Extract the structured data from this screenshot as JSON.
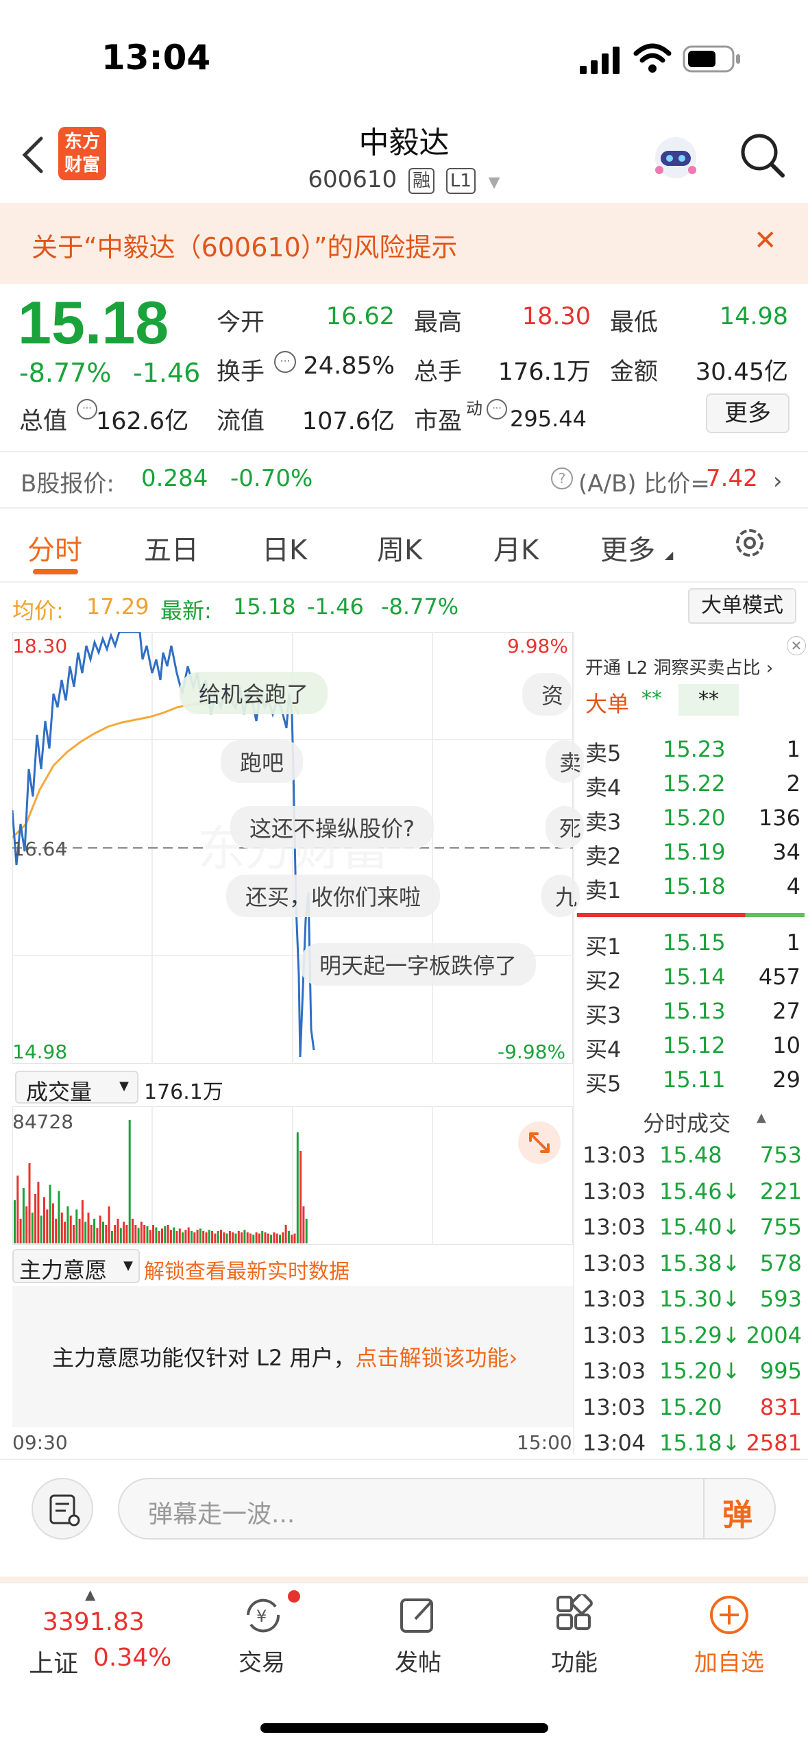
{
  "status_bar": {
    "time": "13:04"
  },
  "header": {
    "logo_text": "东方\n财富",
    "title": "中毅达",
    "code": "600610",
    "tag1": "融",
    "tag2": "L1"
  },
  "risk_banner": {
    "text": "关于“中毅达（600610）”的风险提示",
    "close": "✕"
  },
  "quote": {
    "price": "15.18",
    "change_pct": "-8.77%",
    "change": "-1.46",
    "open_label": "今开",
    "open": "16.62",
    "high_label": "最高",
    "high": "18.30",
    "low_label": "最低",
    "low": "14.98",
    "turnover_label": "换手",
    "turnover": "24.85%",
    "volume_label": "总手",
    "volume": "176.1万",
    "amount_label": "金额",
    "amount": "30.45亿",
    "mktcap_label": "总值",
    "mktcap": "162.6亿",
    "float_label": "流值",
    "float": "107.6亿",
    "pe_label": "市盈",
    "pe_sup": "动",
    "pe": "295.44",
    "more_button": "更多"
  },
  "bshare": {
    "label": "B股报价:",
    "price": "0.284",
    "change": "-0.70%",
    "ratio_label": "(A/B) 比价=",
    "ratio": "7.42"
  },
  "tabs": [
    {
      "label": "分时"
    },
    {
      "label": "五日"
    },
    {
      "label": "日K"
    },
    {
      "label": "周K"
    },
    {
      "label": "月K"
    },
    {
      "label": "更多"
    }
  ],
  "chart_info": {
    "avg_label": "均价:",
    "avg": "17.29",
    "latest_label": "最新:",
    "latest": "15.18",
    "chg": "-1.46",
    "pct": "-8.77%",
    "mode_button": "大单模式"
  },
  "chart_axes": {
    "top_price": "18.30",
    "mid_price": "16.64",
    "bottom_price": "14.98",
    "top_pct": "9.98%",
    "bottom_pct": "-9.98%",
    "start_time": "09:30",
    "end_time": "15:00"
  },
  "bubbles": [
    "给机会跑了",
    "跑吧",
    "这还不操纵股价?",
    "还买，收你们来啦",
    "明天起一字板跌停了",
    "资",
    "卖",
    "死",
    "九"
  ],
  "volume": {
    "selector": "成交量",
    "total": "176.1万",
    "max_label": "84728"
  },
  "main_force": {
    "selector": "主力意愿",
    "unlock_text": "解锁查看最新实时数据",
    "notice": "主力意愿功能仅针对 L2 用户，",
    "notice_link": "点击解锁该功能›"
  },
  "order_book": {
    "promo": "开通 L2 洞察买卖占比 ›",
    "big_order": "大单",
    "big_mask1": "**",
    "big_mask2": "**",
    "asks": [
      {
        "label": "卖5",
        "price": "15.23",
        "vol": "1"
      },
      {
        "label": "卖4",
        "price": "15.22",
        "vol": "2"
      },
      {
        "label": "卖3",
        "price": "15.20",
        "vol": "136"
      },
      {
        "label": "卖2",
        "price": "15.19",
        "vol": "34"
      },
      {
        "label": "卖1",
        "price": "15.18",
        "vol": "4"
      }
    ],
    "bids": [
      {
        "label": "买1",
        "price": "15.15",
        "vol": "1"
      },
      {
        "label": "买2",
        "price": "15.14",
        "vol": "457"
      },
      {
        "label": "买3",
        "price": "15.13",
        "vol": "27"
      },
      {
        "label": "买4",
        "price": "15.12",
        "vol": "10"
      },
      {
        "label": "买5",
        "price": "15.11",
        "vol": "29"
      }
    ]
  },
  "trades": {
    "title": "分时成交",
    "rows": [
      {
        "time": "13:03",
        "price": "15.48",
        "dir": "",
        "vol": "753",
        "color": "green"
      },
      {
        "time": "13:03",
        "price": "15.46",
        "dir": "↓",
        "vol": "221",
        "color": "green"
      },
      {
        "time": "13:03",
        "price": "15.40",
        "dir": "↓",
        "vol": "755",
        "color": "green"
      },
      {
        "time": "13:03",
        "price": "15.38",
        "dir": "↓",
        "vol": "578",
        "color": "green"
      },
      {
        "time": "13:03",
        "price": "15.30",
        "dir": "↓",
        "vol": "593",
        "color": "green"
      },
      {
        "time": "13:03",
        "price": "15.29",
        "dir": "↓",
        "vol": "2004",
        "color": "green"
      },
      {
        "time": "13:03",
        "price": "15.20",
        "dir": "↓",
        "vol": "995",
        "color": "green"
      },
      {
        "time": "13:03",
        "price": "15.20",
        "dir": "",
        "vol": "831",
        "color": "red"
      },
      {
        "time": "13:04",
        "price": "15.18",
        "dir": "↓",
        "vol": "2581",
        "color": "red"
      }
    ]
  },
  "comment_bar": {
    "placeholder": "弹幕走一波...",
    "danmu_button": "弹"
  },
  "bottom_nav": {
    "index_value": "3391.83",
    "index_name": "上证",
    "index_pct": "0.34%",
    "items": [
      {
        "label": "交易"
      },
      {
        "label": "发帖"
      },
      {
        "label": "功能"
      },
      {
        "label": "加自选"
      }
    ]
  },
  "colors": {
    "up": "#e8322e",
    "down": "#1aa33a",
    "accent": "#f06a1c",
    "avg_line": "#f4a93a",
    "price_line": "#2f6fc3"
  }
}
